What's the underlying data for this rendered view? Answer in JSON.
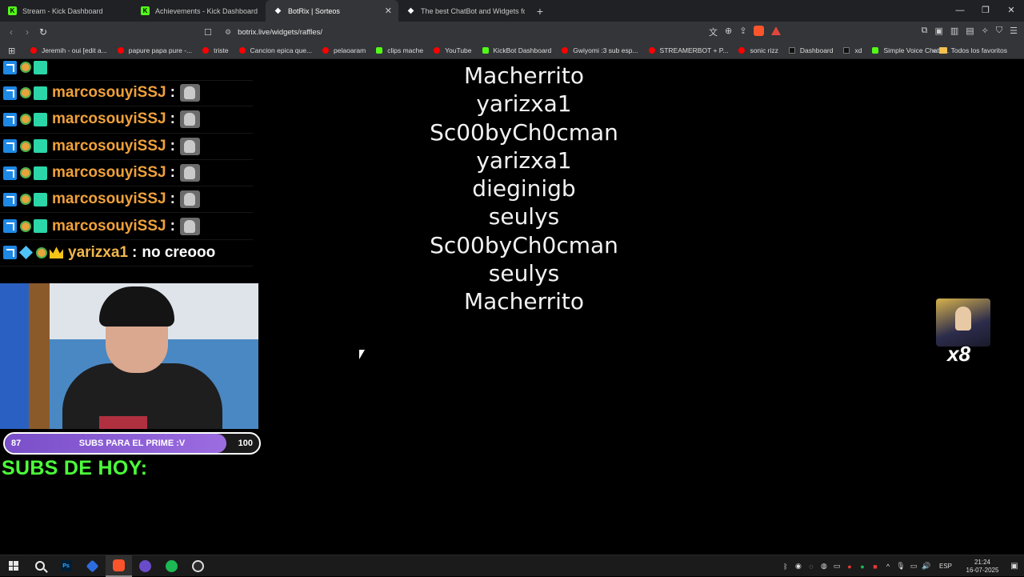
{
  "browser": {
    "tabs": [
      {
        "title": "Stream - Kick Dashboard",
        "icon": "kick-icon",
        "active": false
      },
      {
        "title": "Achievements - Kick Dashboard",
        "icon": "kick-icon",
        "active": false
      },
      {
        "title": "BotRix | Sorteos",
        "icon": "botrix-icon",
        "active": true
      },
      {
        "title": "The best ChatBot and Widgets for Ki",
        "icon": "botrix-icon",
        "active": false
      }
    ],
    "url": "botrix.live/widgets/raffles/",
    "bookmarks": [
      "Jeremih - oui [edit a...",
      "papure papa pure -...",
      "triste",
      "Cancion epica que...",
      "pelaoaram",
      "clips mache",
      "YouTube",
      "KickBot Dashboard",
      "Gwiyomi :3 sub esp...",
      "STREAMERBOT + P...",
      "sonic rizz",
      "Dashboard",
      "xd",
      "Simple Voice Chat -..."
    ],
    "bookmarks_folder": "Todos los favoritos"
  },
  "chat": {
    "rows": [
      {
        "user": "marcosouyiSSJ",
        "message": ""
      },
      {
        "user": "marcosouyiSSJ",
        "message": ""
      },
      {
        "user": "marcosouyiSSJ",
        "message": ""
      },
      {
        "user": "marcosouyiSSJ",
        "message": ""
      },
      {
        "user": "marcosouyiSSJ",
        "message": ""
      },
      {
        "user": "marcosouyiSSJ",
        "message": ""
      }
    ],
    "last": {
      "user": "yarizxa1",
      "message": "no creooo"
    }
  },
  "subgoal": {
    "current": "87",
    "title": "SUBS PARA EL PRIME :V",
    "target": "100",
    "progress": 0.87
  },
  "subs_today_label": "SUBS DE HOY:",
  "raffle_names": [
    "Macherrito",
    "yarizxa1",
    "Sc00byCh0cman",
    "yarizxa1",
    "dieginigb",
    "seulys",
    "Sc00byCh0cman",
    "seulys",
    "Macherrito"
  ],
  "alert": {
    "multiplier": "x8"
  },
  "taskbar": {
    "lang": "ESP",
    "time": "21:24",
    "date": "16-07-2025"
  },
  "colors": {
    "kick_green": "#53fc18",
    "subs_green": "#4cff3a",
    "goal_purple": "#8a5cd6",
    "username_orange": "#f0a13a"
  }
}
